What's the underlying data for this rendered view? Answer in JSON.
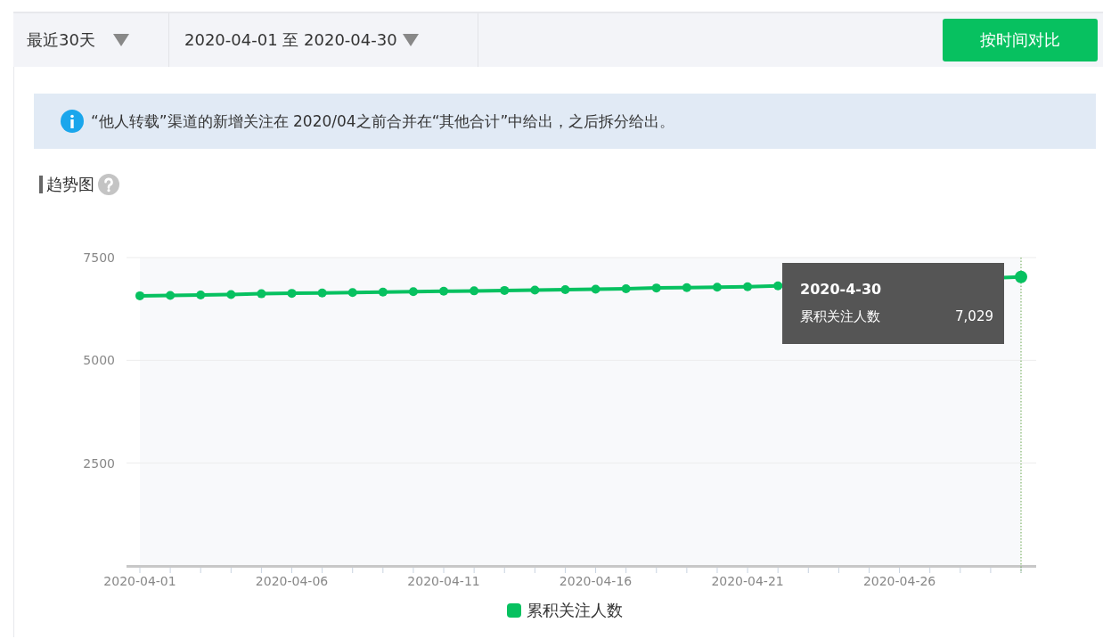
{
  "toolbar": {
    "period_select": {
      "value": "最近30天"
    },
    "date_range_select": {
      "value": "2020-04-01 至 2020-04-30"
    },
    "compare_button": "按时间对比"
  },
  "notice": {
    "text": "“他人转载”渠道的新增关注在 2020/04之前合并在“其他合计”中给出，之后拆分给出。"
  },
  "trend": {
    "title": "趋势图",
    "chart_data": {
      "type": "line",
      "x": [
        "2020-04-01",
        "2020-04-02",
        "2020-04-03",
        "2020-04-04",
        "2020-04-05",
        "2020-04-06",
        "2020-04-07",
        "2020-04-08",
        "2020-04-09",
        "2020-04-10",
        "2020-04-11",
        "2020-04-12",
        "2020-04-13",
        "2020-04-14",
        "2020-04-15",
        "2020-04-16",
        "2020-04-17",
        "2020-04-18",
        "2020-04-19",
        "2020-04-20",
        "2020-04-21",
        "2020-04-22",
        "2020-04-23",
        "2020-04-24",
        "2020-04-25",
        "2020-04-26",
        "2020-04-27",
        "2020-04-28",
        "2020-04-29",
        "2020-04-30"
      ],
      "xticks": [
        {
          "value": "2020-04-01",
          "label": "2020-04-01"
        },
        {
          "value": "2020-04-06",
          "label": "2020-04-06"
        },
        {
          "value": "2020-04-11",
          "label": "2020-04-11"
        },
        {
          "value": "2020-04-16",
          "label": "2020-04-16"
        },
        {
          "value": "2020-04-21",
          "label": "2020-04-21"
        },
        {
          "value": "2020-04-26",
          "label": "2020-04-26"
        }
      ],
      "xlim": [
        "2020-04-01",
        "2020-04-30"
      ],
      "ylim": [
        0,
        7500
      ],
      "yticks": [
        2500,
        5000,
        7500
      ],
      "series": [
        {
          "name": "累积关注人数",
          "color": "#07c160",
          "marker": "circle",
          "values": [
            6570,
            6580,
            6590,
            6600,
            6620,
            6630,
            6640,
            6650,
            6660,
            6670,
            6680,
            6690,
            6700,
            6710,
            6720,
            6730,
            6740,
            6760,
            6770,
            6780,
            6790,
            6810,
            null,
            null,
            null,
            null,
            null,
            null,
            null,
            7029
          ]
        }
      ]
    },
    "tooltip": {
      "date": "2020-4-30",
      "series_label": "累积关注人数",
      "value": "7,029"
    }
  }
}
